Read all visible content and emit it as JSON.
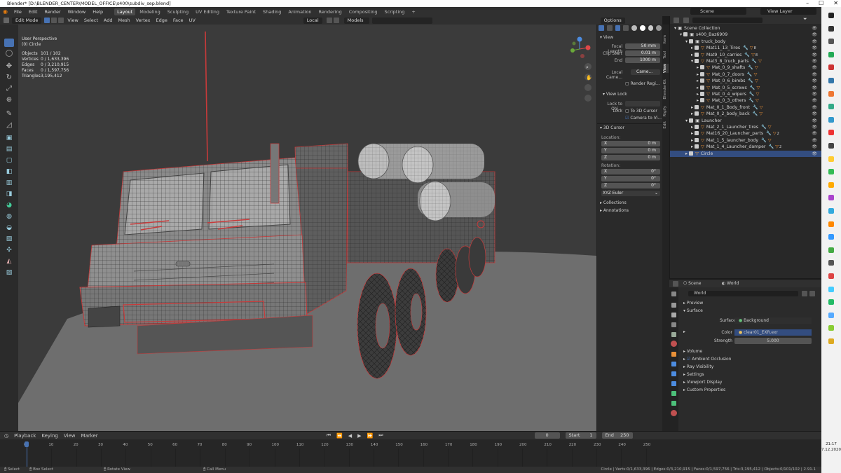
{
  "window": {
    "title": "Blender* [D:\\BLENDER_CENTER\\MODEL_OFFICE\\s400\\subdiv_sep.blend]"
  },
  "menus": [
    "File",
    "Edit",
    "Render",
    "Window",
    "Help"
  ],
  "workspaces": [
    "Layout",
    "Modeling",
    "Sculpting",
    "UV Editing",
    "Texture Paint",
    "Shading",
    "Animation",
    "Rendering",
    "Compositing",
    "Scripting"
  ],
  "workspace_add": "+",
  "scene_field": "Scene",
  "view_layer_field": "View Layer",
  "viewport_header": {
    "mode": "Edit Mode",
    "menus": [
      "View",
      "Select",
      "Add",
      "Mesh",
      "Vertex",
      "Edge",
      "Face",
      "UV"
    ],
    "transform_orientation": "Local",
    "collection_dropdown": "Models",
    "options_label": "Options"
  },
  "viewport_info": {
    "perspective": "User Perspective",
    "object_line": "(0) Circle",
    "stats": [
      {
        "label": "Objects",
        "value": "101 / 102"
      },
      {
        "label": "Vertices",
        "value": "0 / 1,633,396"
      },
      {
        "label": "Edges",
        "value": "0 / 3,210,915"
      },
      {
        "label": "Faces",
        "value": "0 / 1,597,756"
      },
      {
        "label": "Triangles",
        "value": "3,195,412"
      }
    ]
  },
  "npanel": {
    "view_section": "View",
    "focal_length_label": "Focal Length",
    "focal_length": "50 mm",
    "clip_start_label": "Clip Start",
    "clip_start": "0.01 m",
    "clip_end_label": "End",
    "clip_end": "1000 m",
    "local_camera_label": "Local Came...",
    "local_camera_value": "Came...",
    "render_region_label": "Render Regi...",
    "view_lock_label": "View Lock",
    "lock_to_object_label": "Lock to Obj...",
    "lock_label": "Lock",
    "to_3d_cursor": "To 3D Cursor",
    "camera_to_view": "Camera to Vi...",
    "cursor_section": "3D Cursor",
    "location_label": "Location:",
    "loc_x": "0 m",
    "loc_y": "0 m",
    "loc_z": "0 m",
    "rotation_label": "Rotation:",
    "rot_x": "0°",
    "rot_y": "0°",
    "rot_z": "0°",
    "rotation_mode": "XYZ Euler",
    "collections": "Collections",
    "annotations": "Annotations",
    "tabs": [
      "Item",
      "Tool",
      "View",
      "BlenderKit",
      "Rigify",
      "Edit"
    ]
  },
  "outliner": {
    "search_placeholder": "",
    "rows": [
      {
        "label": "Scene Collection",
        "indent": 0
      },
      {
        "label": "s400_Baz6909",
        "indent": 1
      },
      {
        "label": "truck_body",
        "indent": 2
      },
      {
        "label": "Mat11_13_Tires",
        "indent": 3,
        "badge": "8"
      },
      {
        "label": "Mat9_10_carries",
        "indent": 3,
        "badge": "8"
      },
      {
        "label": "Mat3_8_truck_parts",
        "indent": 3
      },
      {
        "label": "Mat_0_9_shafts",
        "indent": 4
      },
      {
        "label": "Mat_0_7_doors",
        "indent": 4
      },
      {
        "label": "Mat_0_6_bimbs",
        "indent": 4
      },
      {
        "label": "Mat_0_5_screws",
        "indent": 4
      },
      {
        "label": "Mat_0_4_wipers",
        "indent": 4
      },
      {
        "label": "Mat_0_3_others",
        "indent": 4
      },
      {
        "label": "Mat_0_1_Body_front",
        "indent": 3
      },
      {
        "label": "Mat_0_2_body_back",
        "indent": 3
      },
      {
        "label": "Launcher",
        "indent": 2
      },
      {
        "label": "Mat_2_1_Launcher_tires",
        "indent": 3
      },
      {
        "label": "Mat16_20_Launcher_parts",
        "indent": 3,
        "badge": "2"
      },
      {
        "label": "Mat_1_5_launcher_body",
        "indent": 3
      },
      {
        "label": "Mat_1_4_Launcher_damper",
        "indent": 3,
        "badge": "2"
      },
      {
        "label": "Circle",
        "indent": 2,
        "selected": true
      }
    ]
  },
  "properties": {
    "scene_tab": "Scene",
    "world_tab": "World",
    "world_name": "World",
    "preview": "Preview",
    "surface_section": "Surface",
    "surface_label": "Surface",
    "surface_value": "Background",
    "color_label": "Color",
    "color_value": "clear01_EXR.exr",
    "strength_label": "Strength",
    "strength_value": "5.000",
    "volume": "Volume",
    "ambient_occlusion": "Ambient Occlusion",
    "ray_visibility": "Ray Visibility",
    "settings": "Settings",
    "viewport_display": "Viewport Display",
    "custom_properties": "Custom Properties"
  },
  "timeline": {
    "menus": [
      "Playback",
      "Keying",
      "View",
      "Marker"
    ],
    "current_frame": "0",
    "start_label": "Start",
    "start": "1",
    "end_label": "End",
    "end": "250",
    "ticks": [
      "0",
      "10",
      "20",
      "30",
      "40",
      "50",
      "60",
      "70",
      "80",
      "90",
      "100",
      "110",
      "120",
      "130",
      "140",
      "150",
      "160",
      "170",
      "180",
      "190",
      "200",
      "210",
      "220",
      "230",
      "240",
      "250"
    ]
  },
  "statusbar": {
    "select": "Select",
    "box_select": "Box Select",
    "rotate_view": "Rotate View",
    "call_menu": "Call Menu",
    "stats": "Circle | Verts:0/1,633,396 | Edges:0/3,210,915 | Faces:0/1,597,756 | Tris:3,195,412 | Objects:0/101/102 | 2.91.1"
  },
  "taskbar": {
    "time": "21:17",
    "date": "7.12.2020"
  },
  "colors": {
    "accent_blue": "#4772b3",
    "selected_row": "#334d80",
    "wire_red": "#c83a3a",
    "outliner_bg": "#282828"
  }
}
